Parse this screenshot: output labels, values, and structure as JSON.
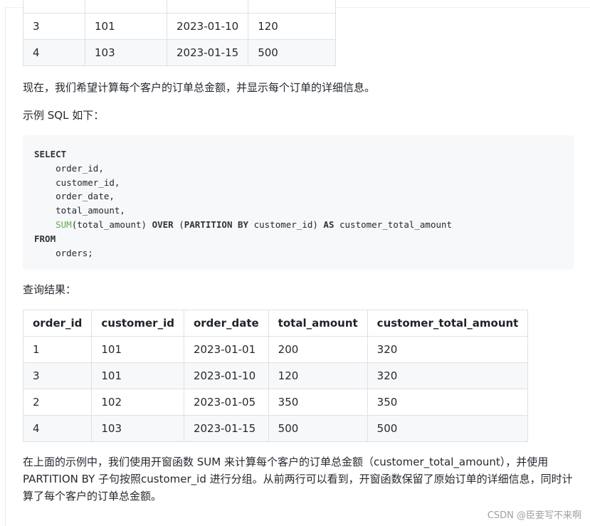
{
  "top_table": {
    "rows": [
      [
        "3",
        "101",
        "2023-01-10",
        "120"
      ],
      [
        "4",
        "103",
        "2023-01-15",
        "500"
      ]
    ]
  },
  "paragraphs": {
    "intro": "现在，我们希望计算每个客户的订单总金额，并显示每个订单的详细信息。",
    "sql_intro": "示例 SQL 如下：",
    "result_intro": "查询结果：",
    "explanation": "在上面的示例中，我们使用开窗函数 SUM 来计算每个客户的订单总金额（customer_total_amount），并使用 PARTITION BY 子句按照customer_id 进行分组。从前两行可以看到，开窗函数保留了原始订单的详细信息，同时计算了每个客户的订单总金额。"
  },
  "code": {
    "select": "SELECT",
    "col1": "order_id,",
    "col2": "customer_id,",
    "col3": "order_date,",
    "col4": "total_amount,",
    "sum_fn": "SUM",
    "sum_arg": "(total_amount) ",
    "over": "OVER",
    "open": " (",
    "partition_by": "PARTITION BY",
    "part_col": " customer_id) ",
    "as": "AS",
    "alias": " customer_total_amount",
    "from": "FROM",
    "table": "orders;"
  },
  "result_table": {
    "headers": [
      "order_id",
      "customer_id",
      "order_date",
      "total_amount",
      "customer_total_amount"
    ],
    "rows": [
      [
        "1",
        "101",
        "2023-01-01",
        "200",
        "320"
      ],
      [
        "3",
        "101",
        "2023-01-10",
        "120",
        "320"
      ],
      [
        "2",
        "102",
        "2023-01-05",
        "350",
        "350"
      ],
      [
        "4",
        "103",
        "2023-01-15",
        "500",
        "500"
      ]
    ]
  },
  "watermark": "CSDN @臣妾写不来啊"
}
